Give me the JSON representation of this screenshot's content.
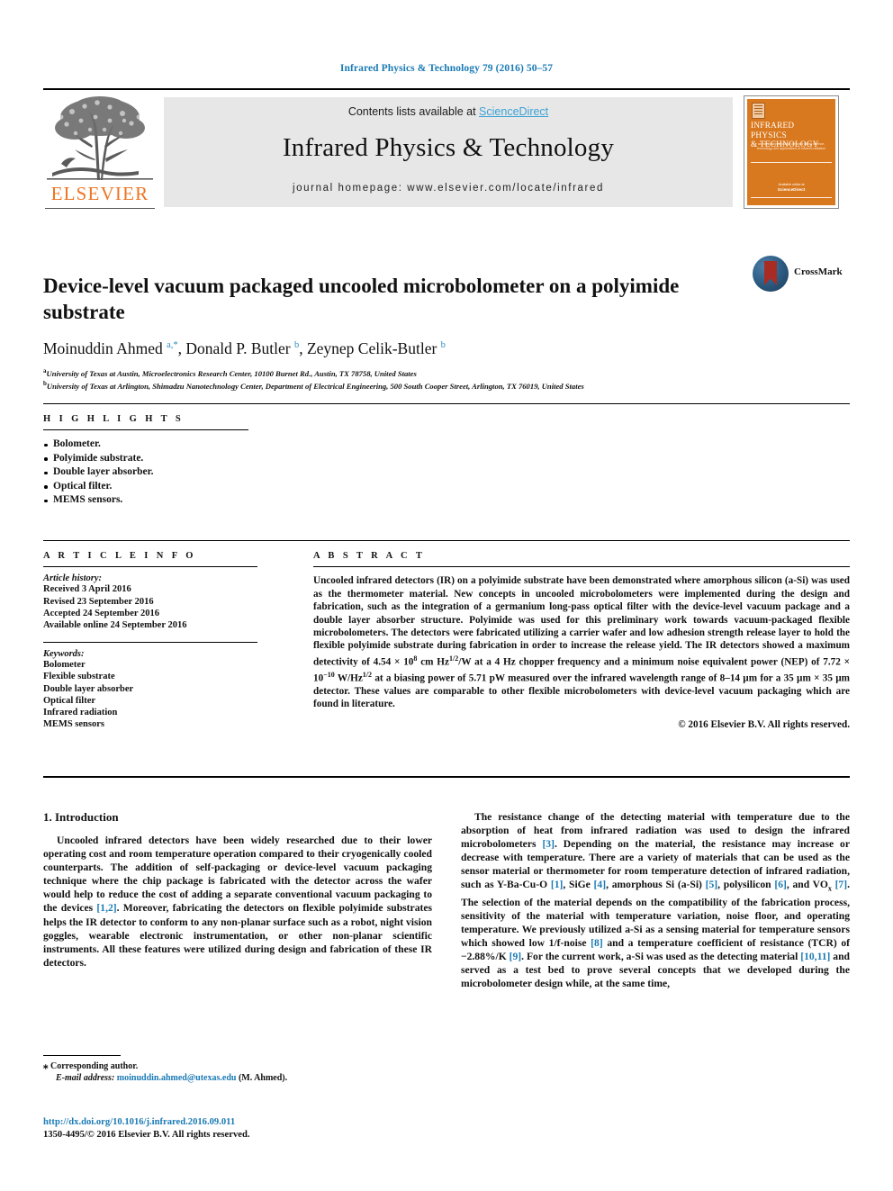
{
  "running_head": "Infrared Physics & Technology 79 (2016) 50–57",
  "masthead": {
    "contents_prefix": "Contents lists available at ",
    "sciencedirect": "ScienceDirect",
    "journal_title": "Infrared Physics & Technology",
    "homepage": "journal homepage: www.elsevier.com/locate/infrared",
    "publisher": "ELSEVIER",
    "cover": {
      "title_line1": "INFRARED PHYSICS",
      "title_line2": "& TECHNOLOGY",
      "subtitle": "an international journal devoted to the science, technology and applications of infrared radiation",
      "foot_small": "Available online at",
      "foot_big": "ScienceDirect"
    },
    "accent_orange": "#d9791f",
    "link_blue": "#3ba2d6"
  },
  "article": {
    "title": "Device-level vacuum packaged uncooled microbolometer on a polyimide substrate",
    "crossmark_label": "CrossMark",
    "authors_html": "Moinuddin Ahmed <sup>a,*</sup>, Donald P. Butler <sup>b</sup>, Zeynep Celik-Butler <sup>b</sup>",
    "affiliations": [
      "University of Texas at Austin, Microelectronics Research Center, 10100 Burnet Rd., Austin, TX 78758, United States",
      "University of Texas at Arlington, Shimadzu Nanotechnology Center, Department of Electrical Engineering, 500 South Cooper Street, Arlington, TX 76019, United States"
    ],
    "affiliation_marks": [
      "a",
      "b"
    ]
  },
  "highlights": {
    "heading": "H I G H L I G H T S",
    "items": [
      "Bolometer.",
      "Polyimide substrate.",
      "Double layer absorber.",
      "Optical filter.",
      "MEMS sensors."
    ]
  },
  "article_info": {
    "heading": "A R T I C L E   I N F O",
    "history_label": "Article history:",
    "history": [
      "Received 3 April 2016",
      "Revised 23 September 2016",
      "Accepted 24 September 2016",
      "Available online 24 September 2016"
    ],
    "keywords_label": "Keywords:",
    "keywords": [
      "Bolometer",
      "Flexible substrate",
      "Double layer absorber",
      "Optical filter",
      "Infrared radiation",
      "MEMS sensors"
    ]
  },
  "abstract": {
    "heading": "A B S T R A C T",
    "body_html": "Uncooled infrared detectors (IR) on a polyimide substrate have been demonstrated where amorphous silicon (a-Si) was used as the thermometer material. New concepts in uncooled microbolometers were implemented during the design and fabrication, such as the integration of a germanium long-pass optical filter with the device-level vacuum package and a double layer absorber structure. Polyimide was used for this preliminary work towards vacuum-packaged flexible microbolometers. The detectors were fabricated utilizing a carrier wafer and low adhesion strength release layer to hold the flexible polyimide substrate during fabrication in order to increase the release yield. The IR detectors showed a maximum detectivity of 4.54 &#215; 10<sup class=\"s\">8</sup> cm Hz<sup class=\"s\">1/2</sup>/W at a 4 Hz chopper frequency and a minimum noise equivalent power (NEP) of 7.72 &#215; 10<sup class=\"s\">&#8722;10</sup> W/Hz<sup class=\"s\">1/2</sup> at a biasing power of 5.71 pW measured over the infrared wavelength range of 8&#8211;14 &#181;m for a 35 &#181;m &#215; 35 &#181;m detector. These values are comparable to other flexible microbolometers with device-level vacuum packaging which are found in literature.",
    "copyright": "© 2016 Elsevier B.V. All rights reserved."
  },
  "body": {
    "section_number_title": "1. Introduction",
    "left_paragraph_html": "Uncooled infrared detectors have been widely researched due to their lower operating cost and room temperature operation compared to their cryogenically cooled counterparts. The addition of self-packaging or device-level vacuum packaging technique where the chip package is fabricated with the detector across the wafer would help to reduce the cost of adding a separate conventional vacuum packaging to the devices <span class=\"ref\">[1,2]</span>. Moreover, fabricating the detectors on flexible polyimide substrates helps the IR detector to conform to any non-planar surface such as a robot, night vision goggles, wearable electronic instrumentation, or other non-planar scientific instruments. All these features were utilized during design and fabrication of these IR detectors.",
    "right_paragraph_html": "The resistance change of the detecting material with temperature due to the absorption of heat from infrared radiation was used to design the infrared microbolometers <span class=\"ref\">[3]</span>. Depending on the material, the resistance may increase or decrease with temperature. There are a variety of materials that can be used as the sensor material or thermometer for room temperature detection of infrared radiation, such as Y-Ba-Cu-O <span class=\"ref\">[1]</span>, SiGe <span class=\"ref\">[4]</span>, amorphous Si (a-Si) <span class=\"ref\">[5]</span>, polysilicon <span class=\"ref\">[6]</span>, and VO<sub class=\"s\">x</sub> <span class=\"ref\">[7]</span>. The selection of the material depends on the compatibility of the fabrication process, sensitivity of the material with temperature variation, noise floor, and operating temperature. We previously utilized a-Si as a sensing material for temperature sensors which showed low 1/f-noise <span class=\"ref\">[8]</span> and a temperature coefficient of resistance (TCR) of &#8722;2.88%/K <span class=\"ref\">[9]</span>. For the current work, a-Si was used as the detecting material <span class=\"ref\">[10,11]</span> and served as a test bed to prove several concepts that we developed during the microbolometer design while, at the same time,"
  },
  "footnote": {
    "corresponding_star": "⁎",
    "corresponding_text": "Corresponding author.",
    "email_label": "E-mail address:",
    "email": "moinuddin.ahmed@utexas.edu",
    "email_owner": "(M. Ahmed)."
  },
  "footer": {
    "doi_url": "http://dx.doi.org/10.1016/j.infrared.2016.09.011",
    "issn_line": "1350-4495/© 2016 Elsevier B.V. All rights reserved."
  }
}
